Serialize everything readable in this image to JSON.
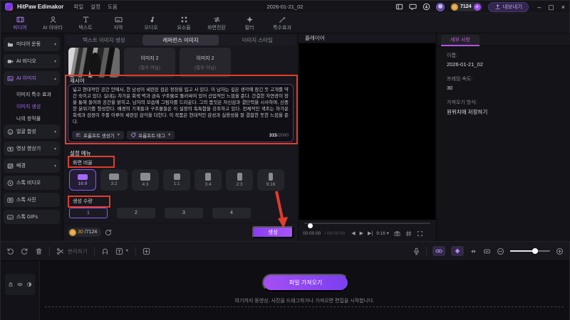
{
  "window": {
    "app_name": "HitPaw Edimakor",
    "menu": [
      "파일",
      "설정",
      "도움"
    ],
    "document_title": "2026-01-21_02",
    "credits": "7124",
    "export_label": "내보내기",
    "minimize": "–",
    "maximize": "▢",
    "close": "×"
  },
  "toolbar": {
    "tabs": [
      {
        "label": "미디어",
        "icon": "media",
        "active": true
      },
      {
        "label": "AI 아바타",
        "icon": "person"
      },
      {
        "label": "텍스트",
        "icon": "text"
      },
      {
        "label": "자막",
        "icon": "subtitle"
      },
      {
        "label": "오디오",
        "icon": "audio"
      },
      {
        "label": "요소들",
        "icon": "elements"
      },
      {
        "label": "화면전환",
        "icon": "transition"
      },
      {
        "label": "필터",
        "icon": "filter"
      },
      {
        "label": "특수효과",
        "icon": "fx"
      }
    ]
  },
  "sidebar": {
    "items": [
      {
        "label": "미디어 운동",
        "icon": "folder",
        "chevron": "▾"
      },
      {
        "label": "AI 비디오",
        "icon": "video",
        "chevron": "▾"
      },
      {
        "label": "AI 이미지",
        "icon": "image",
        "chevron": "▴",
        "active": true
      },
      {
        "label": "이미지 특수 효과",
        "sub": true
      },
      {
        "label": "이미지 생성",
        "sub": true,
        "selected": true
      },
      {
        "label": "나의 창작물",
        "sub": true
      },
      {
        "label": "얼굴 합성",
        "icon": "face",
        "chevron": "▾"
      },
      {
        "label": "영상 향상기",
        "icon": "enhance",
        "chevron": "▾"
      },
      {
        "label": "배경",
        "icon": "background",
        "chevron": "▾"
      },
      {
        "label": "스톡 비디오",
        "icon": "play"
      },
      {
        "label": "스톡 사진",
        "icon": "photo"
      },
      {
        "label": "스톡 GIFs",
        "icon": "gif"
      }
    ]
  },
  "generator": {
    "tabs": [
      {
        "label": "텍스트 이미지 생성"
      },
      {
        "label": "레퍼런스 이미지",
        "active": true
      },
      {
        "label": "이미지 스타일"
      }
    ],
    "reference_slots": [
      {
        "type": "photo"
      },
      {
        "title": "이미지 2",
        "subtitle": "(필수 아님)"
      },
      {
        "title": "이미지 2",
        "subtitle": "(필수 아님)"
      }
    ],
    "prompt_label": "제시어",
    "prompt_text": "넓고 현대적인 공간 안에서, 한 남성이 세련된 검은 정장을 입고 서 있다. 이 남자는 깊은 생각에 잠긴 듯 고개를 약간 숙이고 있다. 실내는 차가운 회색 벽과 금속 구조물로 둘러싸여 있어 산업적인 느낌을 준다. 간결한 자연광이 창을 통해 들어와 공간을 밝히고, 남자의 모습에 그림자를 드리운다. 그의 몸짓은 자신감과 결단력을 시사하며, 신중한 분위기를 형성한다. 배경의 기계들과 구조물들은 이 설정의 독특함을 강조하고 있다. 전체적인 색조는 차가운 회색과 검정이 주를 이루어 세련된 감각을 더한다. 이 작품은 현대적인 감성과 실용성을 잘 결합한 듯한 느낌을 준다.",
    "prompt_generator_label": "프롬프트 생성기",
    "prompt_tag_label": "프롬프트 태그",
    "char_count": "315",
    "char_limit": "/2000",
    "settings_label": "설정 메뉴",
    "aspect_label": "화면 비율",
    "aspect_options": [
      {
        "label": "16:9",
        "selected": true
      },
      {
        "label": "3:2"
      },
      {
        "label": "4:3"
      },
      {
        "label": "1:1"
      },
      {
        "label": "3:4"
      },
      {
        "label": "2:3"
      },
      {
        "label": "9:16"
      }
    ],
    "quantity_label": "생성 수량",
    "quantity_options": [
      {
        "label": "1",
        "selected": true
      },
      {
        "label": "2"
      },
      {
        "label": "3"
      },
      {
        "label": "4"
      }
    ],
    "credits_used": "30",
    "credits_total": "/7124",
    "generate_label": "생성"
  },
  "player": {
    "title": "플레이어",
    "timecode_current": "00:00:00",
    "timecode_total": "/ 00:00:00",
    "ratio": "9:16 ▾"
  },
  "details": {
    "tab_label": "세부 사항",
    "fields": [
      {
        "label": "이름:",
        "value": "2026-01-21_02"
      },
      {
        "label": "프레임 속도:",
        "value": "30"
      },
      {
        "label": "가져오기 방식:",
        "value": "원위치에 저장하기"
      }
    ]
  },
  "timeline": {
    "split_label": "분리하기",
    "import_button": "파일 가져오기",
    "drop_hint": "여기까지 동영상, 사진을 드래그하거나 가져오면 편집을 시작합니다."
  },
  "colors": {
    "accent": "#8a5cf5",
    "annotation": "#e23c2c",
    "coin": "#f0b64a"
  }
}
